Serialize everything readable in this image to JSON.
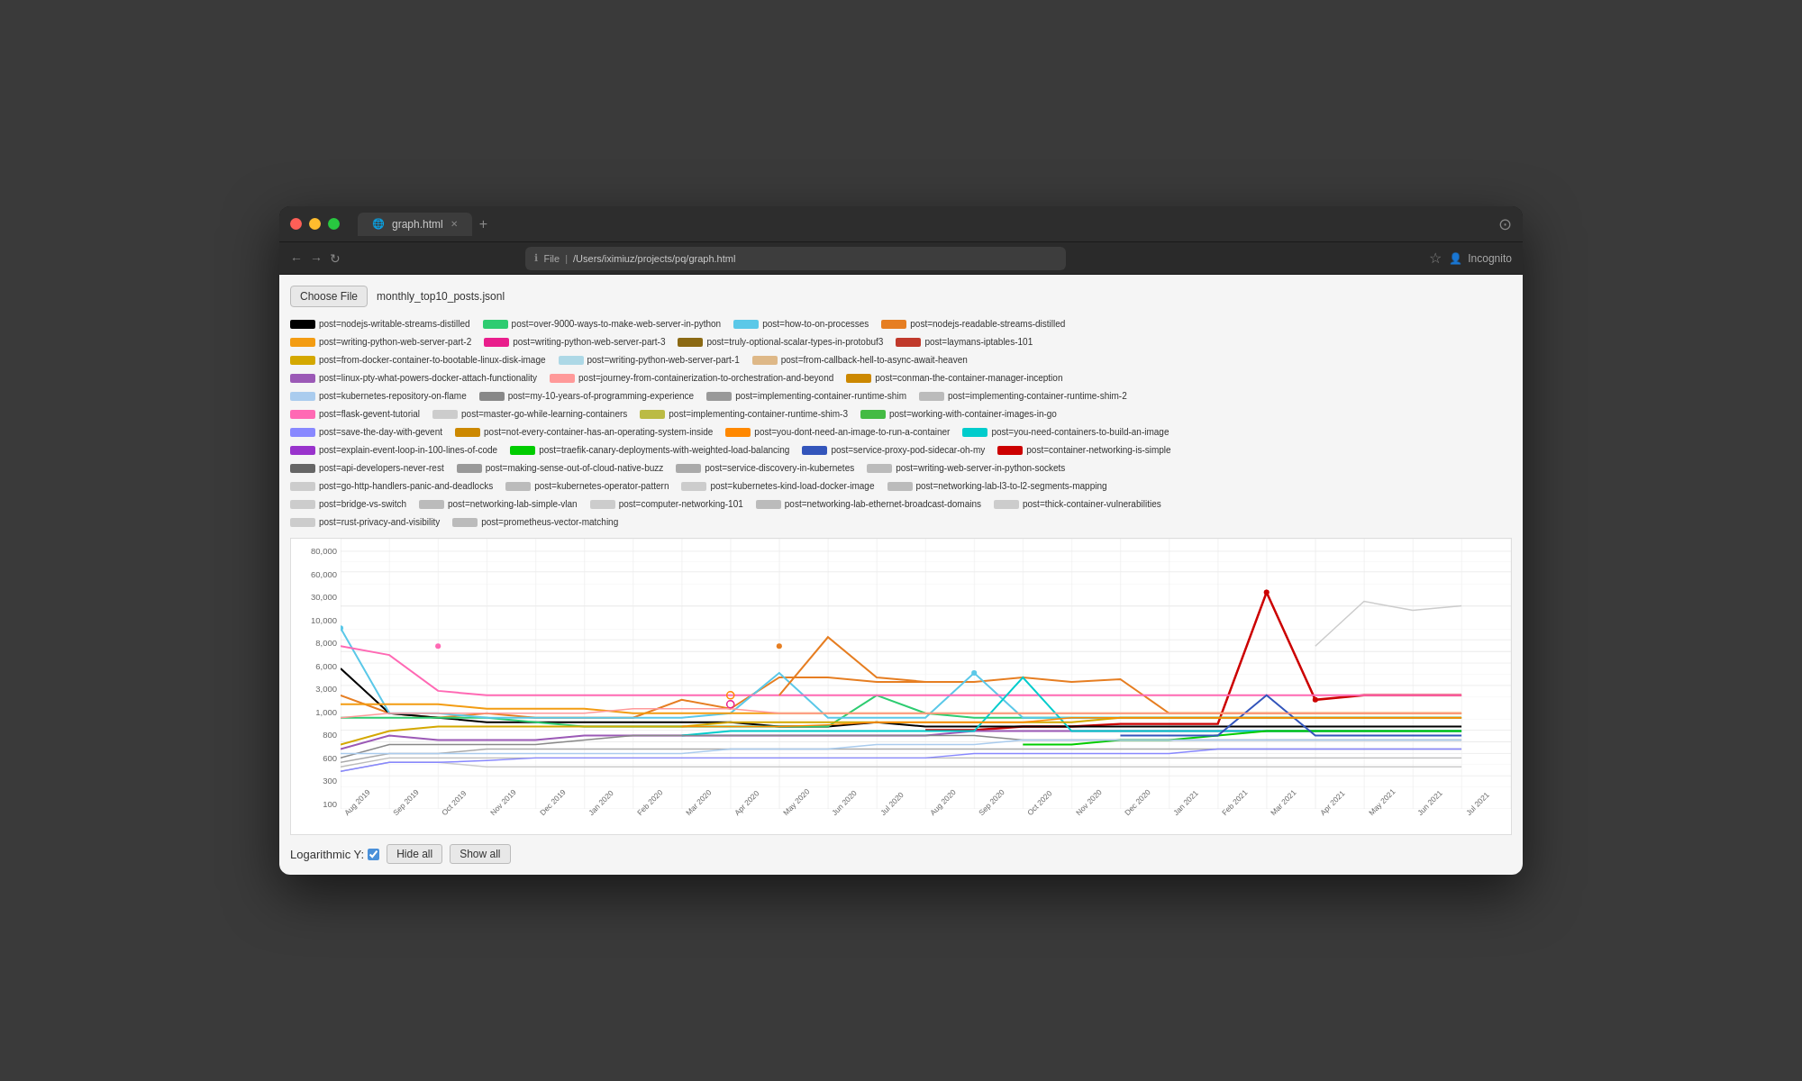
{
  "window": {
    "title": "graph.html",
    "url_protocol": "File",
    "url_path": "/Users/iximiuz/projects/pq/graph.html",
    "incognito_label": "Incognito"
  },
  "toolbar": {
    "choose_file_label": "Choose File",
    "filename": "monthly_top10_posts.jsonl"
  },
  "legend": {
    "items": [
      {
        "label": "post=nodejs-writable-streams-distilled",
        "color": "#000000",
        "border": true
      },
      {
        "label": "post=over-9000-ways-to-make-web-server-in-python",
        "color": "#2ecc71"
      },
      {
        "label": "post=how-to-on-processes",
        "color": "#5bc8e8"
      },
      {
        "label": "post=nodejs-readable-streams-distilled",
        "color": "#e67e22"
      },
      {
        "label": "post=writing-python-web-server-part-2",
        "color": "#f39c12"
      },
      {
        "label": "post=writing-python-web-server-part-3",
        "color": "#e91e8c"
      },
      {
        "label": "post=truly-optional-scalar-types-in-protobuf3",
        "color": "#8b6914"
      },
      {
        "label": "post=laymans-iptables-101",
        "color": "#c0392b"
      },
      {
        "label": "post=from-docker-container-to-bootable-linux-disk-image",
        "color": "#d4a800"
      },
      {
        "label": "post=writing-python-web-server-part-1",
        "color": "#add8e6"
      },
      {
        "label": "post=from-callback-hell-to-async-await-heaven",
        "color": "#deb887"
      },
      {
        "label": "post=linux-pty-what-powers-docker-attach-functionality",
        "color": "#9b59b6"
      },
      {
        "label": "post=journey-from-containerization-to-orchestration-and-beyond",
        "color": "#ff9999"
      },
      {
        "label": "post=conman-the-container-manager-inception",
        "color": "#cc8800"
      },
      {
        "label": "post=kubernetes-repository-on-flame",
        "color": "#aaccee"
      },
      {
        "label": "post=my-10-years-of-programming-experience",
        "color": "#888888"
      },
      {
        "label": "post=implementing-container-runtime-shim",
        "color": "#999999"
      },
      {
        "label": "post=implementing-container-runtime-shim-2",
        "color": "#bbbbbb"
      },
      {
        "label": "post=flask-gevent-tutorial",
        "color": "#ff69b4"
      },
      {
        "label": "post=master-go-while-learning-containers",
        "color": "#bbbbbb"
      },
      {
        "label": "post=implementing-container-runtime-shim-3",
        "color": "#bbbb44"
      },
      {
        "label": "post=working-with-container-images-in-go",
        "color": "#44bb44"
      },
      {
        "label": "post=save-the-day-with-gevent",
        "color": "#8888ff"
      },
      {
        "label": "post=not-every-container-has-an-operating-system-inside",
        "color": "#cc8800"
      },
      {
        "label": "post=you-dont-need-an-image-to-run-a-container",
        "color": "#ff8800"
      },
      {
        "label": "post=you-need-containers-to-build-an-image",
        "color": "#00cccc"
      },
      {
        "label": "post=explain-event-loop-in-100-lines-of-code",
        "color": "#9933cc"
      },
      {
        "label": "post=traefik-canary-deployments-with-weighted-load-balancing",
        "color": "#00cc00"
      },
      {
        "label": "post=service-proxy-pod-sidecar-oh-my",
        "color": "#3355bb"
      },
      {
        "label": "post=container-networking-is-simple",
        "color": "#cc0000"
      },
      {
        "label": "post=api-developers-never-rest",
        "color": "#555555"
      },
      {
        "label": "post=making-sense-out-of-cloud-native-buzz",
        "color": "#888888"
      },
      {
        "label": "post=service-discovery-in-kubernetes",
        "color": "#aaaaaa"
      },
      {
        "label": "post=writing-web-server-in-python-sockets",
        "color": "#bbbbbb"
      },
      {
        "label": "post=go-http-handlers-panic-and-deadlocks",
        "color": "#cccccc"
      },
      {
        "label": "post=kubernetes-operator-pattern",
        "color": "#bbbbbb"
      },
      {
        "label": "post=kubernetes-kind-load-docker-image",
        "color": "#cccccc"
      },
      {
        "label": "post=networking-lab-l3-to-l2-segments-mapping",
        "color": "#bbbbbb"
      },
      {
        "label": "post=bridge-vs-switch",
        "color": "#cccccc"
      },
      {
        "label": "post=networking-lab-simple-vlan",
        "color": "#bbbbbb"
      },
      {
        "label": "post=computer-networking-101",
        "color": "#cccccc"
      },
      {
        "label": "post=networking-lab-ethernet-broadcast-domains",
        "color": "#bbbbbb"
      },
      {
        "label": "post=thick-container-vulnerabilities",
        "color": "#cccccc"
      },
      {
        "label": "post=rust-privacy-and-visibility",
        "color": "#cccccc"
      },
      {
        "label": "post=prometheus-vector-matching",
        "color": "#bbbbbb"
      }
    ]
  },
  "chart": {
    "y_labels": [
      "80,000",
      "60,000",
      "30,000",
      "10,000",
      "8,000",
      "6,000",
      "3,000",
      "1,000",
      "800",
      "600",
      "300",
      "100"
    ],
    "x_labels": [
      "Aug 2019",
      "Sep 2019",
      "Oct 2019",
      "Nov 2019",
      "Dec 2019",
      "Jan 2020",
      "Feb 2020",
      "Mar 2020",
      "Apr 2020",
      "May 2020",
      "Jun 2020",
      "Jul 2020",
      "Aug 2020",
      "Sep 2020",
      "Oct 2020",
      "Nov 2020",
      "Dec 2020",
      "Jan 2021",
      "Feb 2021",
      "Mar 2021",
      "Apr 2021",
      "May 2021",
      "Jun 2021",
      "Jul 2021"
    ]
  },
  "bottom": {
    "log_label": "Logarithmic Y:",
    "hide_all_label": "Hide all",
    "show_all_label": "Show all"
  }
}
